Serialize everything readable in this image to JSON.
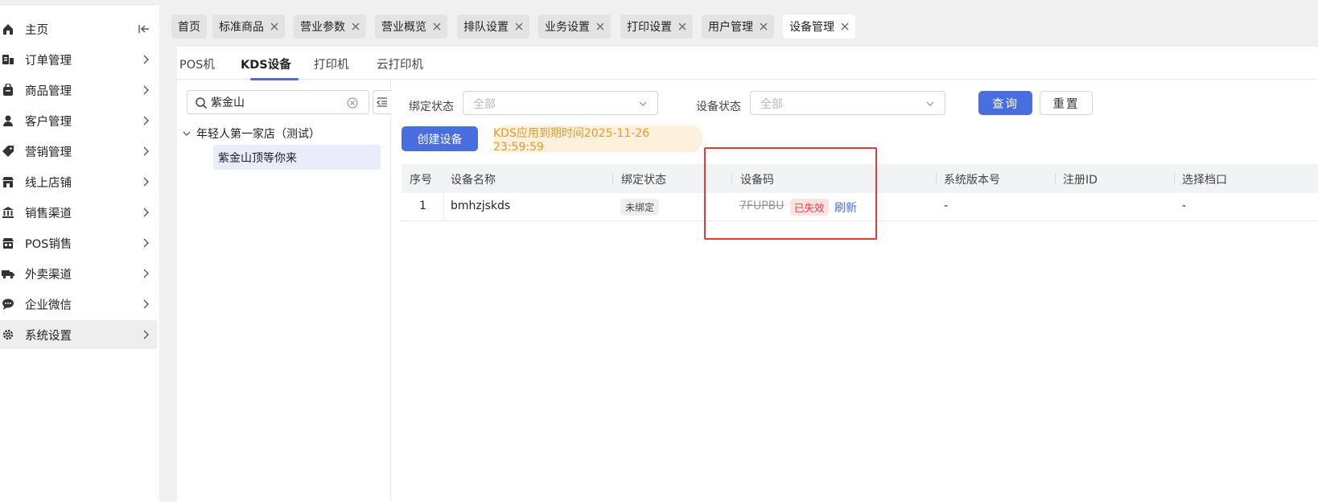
{
  "sidebar": {
    "items": [
      {
        "label": "主页",
        "icon": "home-icon"
      },
      {
        "label": "订单管理",
        "icon": "order-icon"
      },
      {
        "label": "商品管理",
        "icon": "bag-icon"
      },
      {
        "label": "客户管理",
        "icon": "user-icon"
      },
      {
        "label": "营销管理",
        "icon": "tag-icon"
      },
      {
        "label": "线上店铺",
        "icon": "shop-icon"
      },
      {
        "label": "销售渠道",
        "icon": "bank-icon"
      },
      {
        "label": "POS销售",
        "icon": "store-icon"
      },
      {
        "label": "外卖渠道",
        "icon": "truck-icon"
      },
      {
        "label": "企业微信",
        "icon": "chat-icon"
      },
      {
        "label": "系统设置",
        "icon": "gear-icon"
      }
    ],
    "active": "系统设置"
  },
  "tabs": [
    {
      "label": "首页",
      "closable": false
    },
    {
      "label": "标准商品",
      "closable": true
    },
    {
      "label": "营业参数",
      "closable": true
    },
    {
      "label": "营业概览",
      "closable": true
    },
    {
      "label": "排队设置",
      "closable": true
    },
    {
      "label": "业务设置",
      "closable": true
    },
    {
      "label": "打印设置",
      "closable": true
    },
    {
      "label": "用户管理",
      "closable": true
    },
    {
      "label": "设备管理",
      "closable": true,
      "active": true
    }
  ],
  "subtabs": [
    "POS机",
    "KDS设备",
    "打印机",
    "云打印机"
  ],
  "tree": {
    "search_value": "紫金山",
    "root": "年轻人第一家店（测试）",
    "leaf": "紫金山顶等你来"
  },
  "filters": {
    "bind_label": "绑定状态",
    "bind_placeholder": "全部",
    "device_label": "设备状态",
    "device_placeholder": "全部",
    "query": "查询",
    "reset": "重置"
  },
  "create_button": "创建设备",
  "expiry_notice": "KDS应用到期时间2025-11-26 23:59:59",
  "table": {
    "headers": [
      "序号",
      "设备名称",
      "绑定状态",
      "设备码",
      "系统版本号",
      "注册ID",
      "选择档口"
    ],
    "rows": [
      {
        "index": "1",
        "name": "bmhzjskds",
        "bind_status": "未绑定",
        "code": "7FUPBU",
        "code_status": "已失效",
        "refresh": "刷新",
        "version": "-",
        "reg_id": "",
        "stall": "-"
      }
    ]
  },
  "colors": {
    "primary": "#4a6ee0",
    "warning_text": "#e29a2e",
    "warning_bg": "#fdf0dc",
    "danger": "#e0413b",
    "highlight_box": "#e23b3b"
  }
}
